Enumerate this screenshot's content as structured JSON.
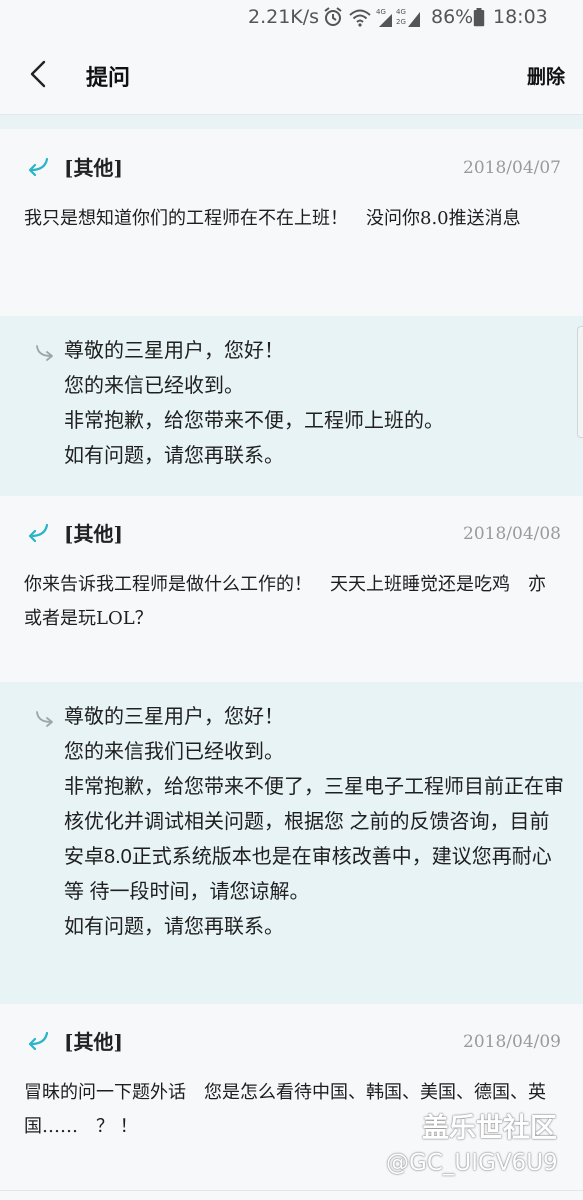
{
  "status_bar": {
    "network_speed": "2.21K/s",
    "battery_percent": "86%",
    "time": "18:03",
    "icons": [
      "alarm-icon",
      "wifi-icon",
      "4g-signal-icon",
      "4g-2g-signal-icon",
      "battery-icon"
    ]
  },
  "header": {
    "title": "提问",
    "delete_label": "删除"
  },
  "colors": {
    "accent": "#2bb3c8",
    "reply_background": "#e8f3f5",
    "date_text": "#9a9a9a"
  },
  "threads": [
    {
      "category": "[其他]",
      "date": "2018/04/07",
      "question": "我只是想知道你们的工程师在不在上班！　没问你8.0推送消息",
      "reply": [
        "尊敬的三星用户，您好！",
        "您的来信已经收到。",
        "非常抱歉，给您带来不便，工程师上班的。",
        "如有问题，请您再联系。"
      ]
    },
    {
      "category": "[其他]",
      "date": "2018/04/08",
      "question": "你来告诉我工程师是做什么工作的！　天天上班睡觉还是吃鸡　亦或者是玩LOL？",
      "reply": [
        "尊敬的三星用户，您好！",
        "您的来信我们已经收到。",
        "非常抱歉，给您带来不便了，三星电子工程师目前正在审核优化并调试相关问题，根据您 之前的反馈咨询，目前安卓8.0正式系统版本也是在审核改善中，建议您再耐心等 待一段时间，请您谅解。",
        "如有问题，请您再联系。"
      ]
    },
    {
      "category": "[其他]",
      "date": "2018/04/09",
      "question": "冒昧的问一下题外话　您是怎么看待中国、韩国、美国、德国、英国……　？ ！"
    }
  ],
  "watermark": {
    "logo_text": "盖乐世社区",
    "user_id": "@GC_UIGV6U9"
  }
}
